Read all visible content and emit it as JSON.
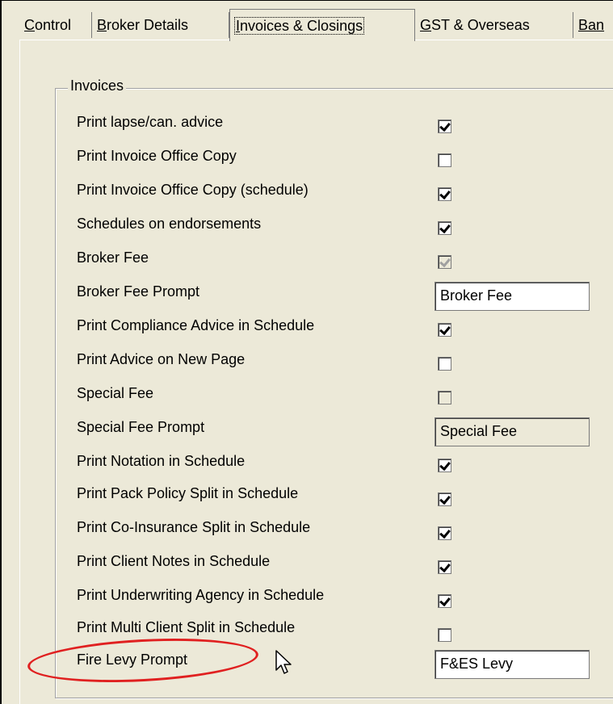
{
  "tabs": [
    {
      "pre": "",
      "acc": "C",
      "post": "ontrol"
    },
    {
      "pre": "",
      "acc": "B",
      "post": "roker Details"
    },
    {
      "pre": "",
      "acc": "I",
      "post": "nvoices & Closings"
    },
    {
      "pre": "",
      "acc": "G",
      "post": "ST & Overseas"
    },
    {
      "pre": "",
      "acc": "Ban",
      "post": ""
    }
  ],
  "group_title": "Invoices",
  "rows": {
    "r0": {
      "label": "Print lapse/can. advice",
      "checked": true,
      "enabled": true
    },
    "r1": {
      "label": "Print Invoice Office Copy",
      "checked": false,
      "enabled": true
    },
    "r2": {
      "label": "Print Invoice Office Copy (schedule)",
      "checked": true,
      "enabled": true
    },
    "r3": {
      "label": "Schedules on endorsements",
      "checked": true,
      "enabled": true
    },
    "r4": {
      "label": "Broker Fee",
      "checked": true,
      "enabled": false
    },
    "r5": {
      "label": "Broker Fee Prompt",
      "value": "Broker Fee",
      "enabled": true
    },
    "r6": {
      "label": "Print Compliance Advice in Schedule",
      "checked": true,
      "enabled": true
    },
    "r7": {
      "label": "Print Advice on New Page",
      "checked": false,
      "enabled": true
    },
    "r8": {
      "label": "Special Fee",
      "checked": false,
      "enabled": false
    },
    "r9": {
      "label": "Special Fee Prompt",
      "value": "Special Fee",
      "enabled": false
    },
    "r10": {
      "label": "Print Notation in Schedule",
      "checked": true,
      "enabled": true
    },
    "r11": {
      "label": "Print Pack Policy Split in Schedule",
      "checked": true,
      "enabled": true
    },
    "r12": {
      "label": "Print Co-Insurance Split in Schedule",
      "checked": true,
      "enabled": true
    },
    "r13": {
      "label": "Print Client Notes in Schedule",
      "checked": true,
      "enabled": true
    },
    "r14": {
      "label": "Print Underwriting Agency in Schedule",
      "checked": true,
      "enabled": true
    },
    "r15": {
      "label": "Print Multi Client Split in Schedule",
      "checked": false,
      "enabled": true
    },
    "r16": {
      "label": "Fire Levy Prompt",
      "value": "F&ES Levy",
      "enabled": true
    }
  },
  "highlight_color": "#e02020"
}
